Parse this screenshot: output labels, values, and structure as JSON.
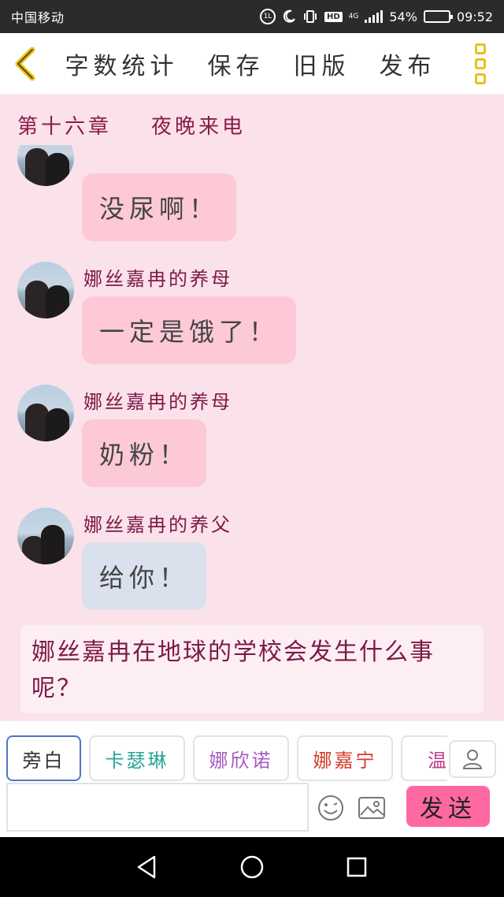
{
  "status_bar": {
    "carrier": "中国移动",
    "network": "4G",
    "battery": "54%",
    "battery_level": 0.54,
    "time": "09:52",
    "hd_label": "HD"
  },
  "toolbar": {
    "actions": [
      "字数统计",
      "保存",
      "旧版",
      "发布"
    ]
  },
  "chapter": {
    "number": "第十六章",
    "title": "夜晚来电"
  },
  "messages": [
    {
      "sender": "",
      "text": "没尿啊！",
      "bubble": "pink"
    },
    {
      "sender": "娜丝嘉冉的养母",
      "text": "一定是饿了！",
      "bubble": "pink"
    },
    {
      "sender": "娜丝嘉冉的养母",
      "text": "奶粉！",
      "bubble": "pink"
    },
    {
      "sender": "娜丝嘉冉的养父",
      "text": "给你！",
      "bubble": "blue"
    }
  ],
  "narration": "娜丝嘉冉在地球的学校会发生什么事呢？",
  "characters": [
    "旁白",
    "卡瑟琳",
    "娜欣诺",
    "娜嘉宁",
    "温暖"
  ],
  "input": {
    "value": "",
    "placeholder": ""
  },
  "send_label": "发送",
  "colors": {
    "background": "#fbe1ea",
    "accent": "#ff69a1",
    "chapter_text": "#8a1c4a",
    "menu_icon": "#e8c21e"
  }
}
